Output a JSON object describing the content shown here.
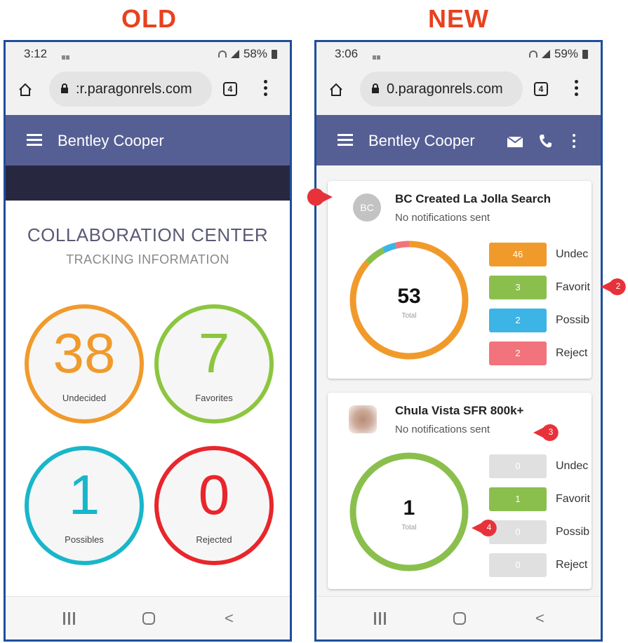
{
  "headings": {
    "old": "OLD",
    "new": "NEW"
  },
  "old": {
    "status": {
      "time": "3:12",
      "battery": "58%"
    },
    "browser": {
      "url": ":r.paragonrels.com",
      "tab_count": "4"
    },
    "appbar": {
      "title": "Bentley Cooper"
    },
    "content": {
      "title": "COLLABORATION CENTER",
      "subtitle": "TRACKING INFORMATION",
      "stats": [
        {
          "value": "38",
          "label": "Undecided",
          "color": "#f19a2c"
        },
        {
          "value": "7",
          "label": "Favorites",
          "color": "#8cc63f"
        },
        {
          "value": "1",
          "label": "Possibles",
          "color": "#19b6ca"
        },
        {
          "value": "0",
          "label": "Rejected",
          "color": "#e8262c"
        }
      ]
    }
  },
  "new": {
    "status": {
      "time": "3:06",
      "battery": "59%"
    },
    "browser": {
      "url": "0.paragonrels.com",
      "tab_count": "4"
    },
    "appbar": {
      "title": "Bentley Cooper"
    },
    "cards": [
      {
        "avatar": "BC",
        "title": "BC Created La Jolla Search",
        "subtitle": "No notifications sent",
        "total": "53",
        "total_label": "Total",
        "legend": [
          {
            "value": "46",
            "label": "Undec",
            "color": "#f19a2c"
          },
          {
            "value": "3",
            "label": "Favorit",
            "color": "#8bbf4d"
          },
          {
            "value": "2",
            "label": "Possib",
            "color": "#3cb4e5"
          },
          {
            "value": "2",
            "label": "Reject",
            "color": "#f2737b"
          }
        ]
      },
      {
        "avatar": "",
        "title": "Chula Vista SFR 800k+",
        "subtitle": "No notifications sent",
        "total": "1",
        "total_label": "Total",
        "legend": [
          {
            "value": "0",
            "label": "Undec",
            "color": "#e0e0e0"
          },
          {
            "value": "1",
            "label": "Favorit",
            "color": "#8bbf4d"
          },
          {
            "value": "0",
            "label": "Possib",
            "color": "#e0e0e0"
          },
          {
            "value": "0",
            "label": "Reject",
            "color": "#e0e0e0"
          }
        ]
      }
    ],
    "markers": [
      "1",
      "2",
      "3",
      "4"
    ],
    "marker_color": "#e8323a"
  }
}
